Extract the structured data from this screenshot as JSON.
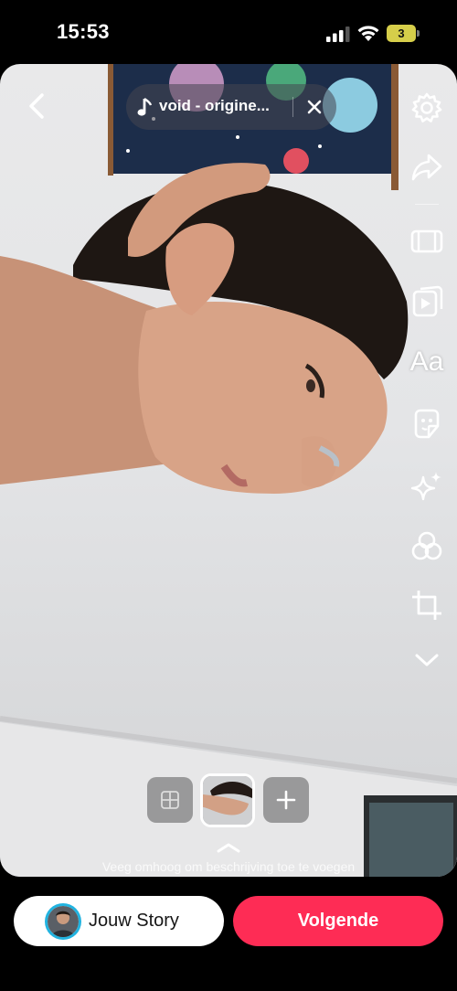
{
  "status_bar": {
    "time": "15:53",
    "battery_level": "3",
    "icons": [
      "signal-icon",
      "wifi-icon",
      "battery-icon"
    ]
  },
  "editor": {
    "music_title": "void - origine...",
    "icons": {
      "back": "chevron-left-icon",
      "music": "music-note-icon",
      "close": "close-icon"
    },
    "tools": [
      {
        "name": "settings",
        "icon": "gear-icon"
      },
      {
        "name": "share",
        "icon": "share-arrow-icon"
      },
      {
        "name": "format",
        "icon": "frame-icon"
      },
      {
        "name": "templates",
        "icon": "video-cards-icon"
      },
      {
        "name": "text",
        "label": "Aa"
      },
      {
        "name": "stickers",
        "icon": "sticker-icon"
      },
      {
        "name": "effects",
        "icon": "sparkle-icon"
      },
      {
        "name": "filters",
        "icon": "filters-icon"
      },
      {
        "name": "crop",
        "icon": "crop-icon"
      },
      {
        "name": "more",
        "icon": "chevron-down-icon"
      }
    ],
    "hint_text": "Veeg omhoog om beschrijving toe te voegen"
  },
  "bottom_bar": {
    "story_label": "Jouw Story",
    "next_label": "Volgende"
  },
  "colors": {
    "accent": "#fe2c55",
    "story_ring": "#21b3e0",
    "battery": "#d6ce4a"
  }
}
